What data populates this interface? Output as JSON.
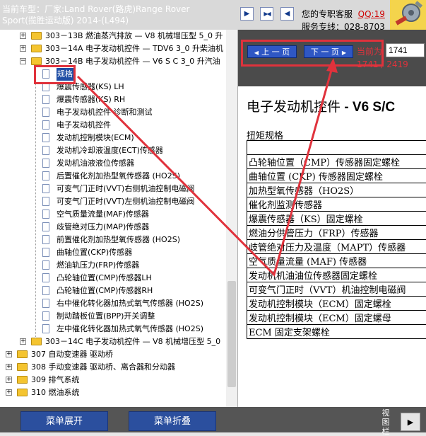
{
  "header": {
    "car_line1": "当前车型：厂家:Land Rover(路虎)Range Rover",
    "car_line2": "Sport(揽胜运动版) 2014-(L494)",
    "support_line1": "您的专职客服",
    "support_qq": "QQ:19",
    "support_line2": "服务专线：028-8703",
    "nav_first_icon": "▶",
    "nav_middle_icon": "▶◀",
    "nav_last_icon": "◀"
  },
  "tree": {
    "items": [
      {
        "label": "303－13B 燃油蒸汽排放 — V8 机械增压型 5_0 升",
        "type": "folder",
        "level": 1,
        "expander": "+"
      },
      {
        "label": "303－14A 电子发动机控件 — TDV6 3_0 升柴油机",
        "type": "folder",
        "level": 1,
        "expander": "+"
      },
      {
        "label": "303－14B 电子发动机控件 — V6 S C 3_0 升汽油",
        "type": "folder",
        "level": 1,
        "expander": "−"
      },
      {
        "label": "规格",
        "type": "doc",
        "level": 2,
        "selected": true
      },
      {
        "label": "爆震传感器(KS) LH",
        "type": "doc",
        "level": 2
      },
      {
        "label": "爆震传感器(KS) RH",
        "type": "doc",
        "level": 2
      },
      {
        "label": "电子发动机控件 诊断和测试",
        "type": "doc",
        "level": 2
      },
      {
        "label": "电子发动机控件",
        "type": "doc",
        "level": 2
      },
      {
        "label": "发动机控制模块(ECM)",
        "type": "doc",
        "level": 2
      },
      {
        "label": "发动机冷却液温度(ECT)传感器",
        "type": "doc",
        "level": 2
      },
      {
        "label": "发动机油液液位传感器",
        "type": "doc",
        "level": 2
      },
      {
        "label": "后置催化剂加热型氧传感器 (HO2S)",
        "type": "doc",
        "level": 2
      },
      {
        "label": "可变气门正时(VVT)右侧机油控制电磁阀",
        "type": "doc",
        "level": 2
      },
      {
        "label": "可变气门正时(VVT)左侧机油控制电磁阀",
        "type": "doc",
        "level": 2
      },
      {
        "label": "空气质量流量(MAF)传感器",
        "type": "doc",
        "level": 2
      },
      {
        "label": "歧管绝对压力(MAP)传感器",
        "type": "doc",
        "level": 2
      },
      {
        "label": "前置催化剂加热型氧传感器 (HO2S)",
        "type": "doc",
        "level": 2
      },
      {
        "label": "曲轴位置(CKP)传感器",
        "type": "doc",
        "level": 2
      },
      {
        "label": "燃油轨压力(FRP)传感器",
        "type": "doc",
        "level": 2
      },
      {
        "label": "凸轮轴位置(CMP)传感器LH",
        "type": "doc",
        "level": 2
      },
      {
        "label": "凸轮轴位置(CMP)传感器RH",
        "type": "doc",
        "level": 2
      },
      {
        "label": "右中催化转化器加热式氧气传感器 (HO2S)",
        "type": "doc",
        "level": 2
      },
      {
        "label": "制动踏板位置(BPP)开关调整",
        "type": "doc",
        "level": 2
      },
      {
        "label": "左中催化转化器加热式氧气传感器 (HO2S)",
        "type": "doc",
        "level": 2
      },
      {
        "label": "303－14C 电子发动机控件 — V8 机械增压型 5_0",
        "type": "folder",
        "level": 1,
        "expander": "+"
      },
      {
        "label": "307 自动变速器 驱动桥",
        "type": "folder",
        "level": 0,
        "expander": "+"
      },
      {
        "label": "308 手动变速器 驱动桥、离合器和分动器",
        "type": "folder",
        "level": 0,
        "expander": "+"
      },
      {
        "label": "309 排气系统",
        "type": "folder",
        "level": 0,
        "expander": "+"
      },
      {
        "label": "310 燃油系统",
        "type": "folder",
        "level": 0,
        "expander": "+"
      }
    ]
  },
  "pager": {
    "prev_label": "上 一 页",
    "next_label": "下 一 页",
    "current_label": "当前为",
    "page_value": "1741",
    "page_count": "1741 / 2419"
  },
  "document": {
    "title_cn": "电子发动机控件",
    "title_en": " - V6 S/C",
    "torque_heading": "扭矩规格",
    "rows": [
      "",
      "凸轮轴位置（CMP）传感器固定螺栓",
      "曲轴位置 (CKP) 传感器固定螺栓",
      "加热型氧传感器（HO2S）",
      "催化剂监测传感器",
      "爆震传感器（KS）固定螺栓",
      "燃油分供管压力（FRP）传感器",
      "歧管绝对压力及温度（MAPT）传感器",
      "空气质量流量 (MAF) 传感器",
      "发动机机油油位传感器固定螺栓",
      "可变气门正时（VVT）机油控制电磁阀",
      "发动机控制模块（ECM）固定螺栓",
      "发动机控制模块（ECM）固定螺母",
      "ECM 固定支架螺栓"
    ]
  },
  "bottom": {
    "expand_label": "菜单展开",
    "collapse_label": "菜单折叠",
    "view_label": "视图栏",
    "view_btn_icon": "▶"
  },
  "colors": {
    "highlight_red": "#e0323c",
    "button_blue": "#2f57c4",
    "selected_blue": "#1f4ea5"
  }
}
